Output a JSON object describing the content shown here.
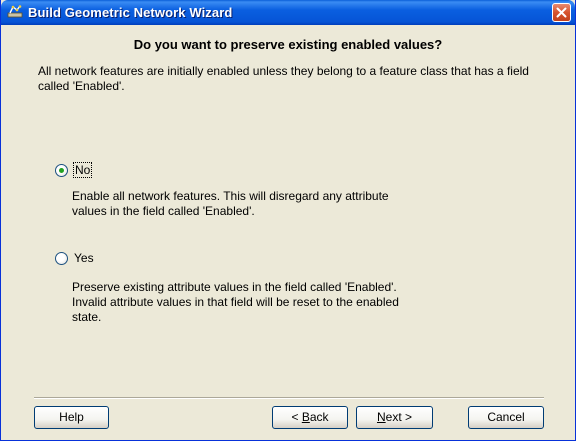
{
  "window": {
    "title": "Build Geometric Network Wizard"
  },
  "heading": "Do you want to preserve existing enabled values?",
  "intro": "All network features are initially enabled unless they belong to a feature class that has a field called 'Enabled'.",
  "options": [
    {
      "label": "No",
      "selected": true,
      "description_lines": [
        "Enable all network features.  This will disregard any attribute",
        "values in the field called 'Enabled'."
      ]
    },
    {
      "label": "Yes",
      "selected": false,
      "description_lines": [
        "Preserve existing attribute values in the field called 'Enabled'.",
        "Invalid attribute values in that field will be reset to the enabled",
        "state."
      ]
    }
  ],
  "buttons": {
    "help": "Help",
    "back_prefix": "< ",
    "back_mnemonic": "B",
    "back_rest": "ack",
    "next_mnemonic": "N",
    "next_rest": "ext >",
    "cancel": "Cancel"
  },
  "icons": {
    "app": "network-wizard-icon",
    "close": "close-icon"
  },
  "colors": {
    "titlebar": "#0a5fd8",
    "close": "#d7532d",
    "dialog_bg": "#ece9d8",
    "radio_dot": "#21a121"
  }
}
